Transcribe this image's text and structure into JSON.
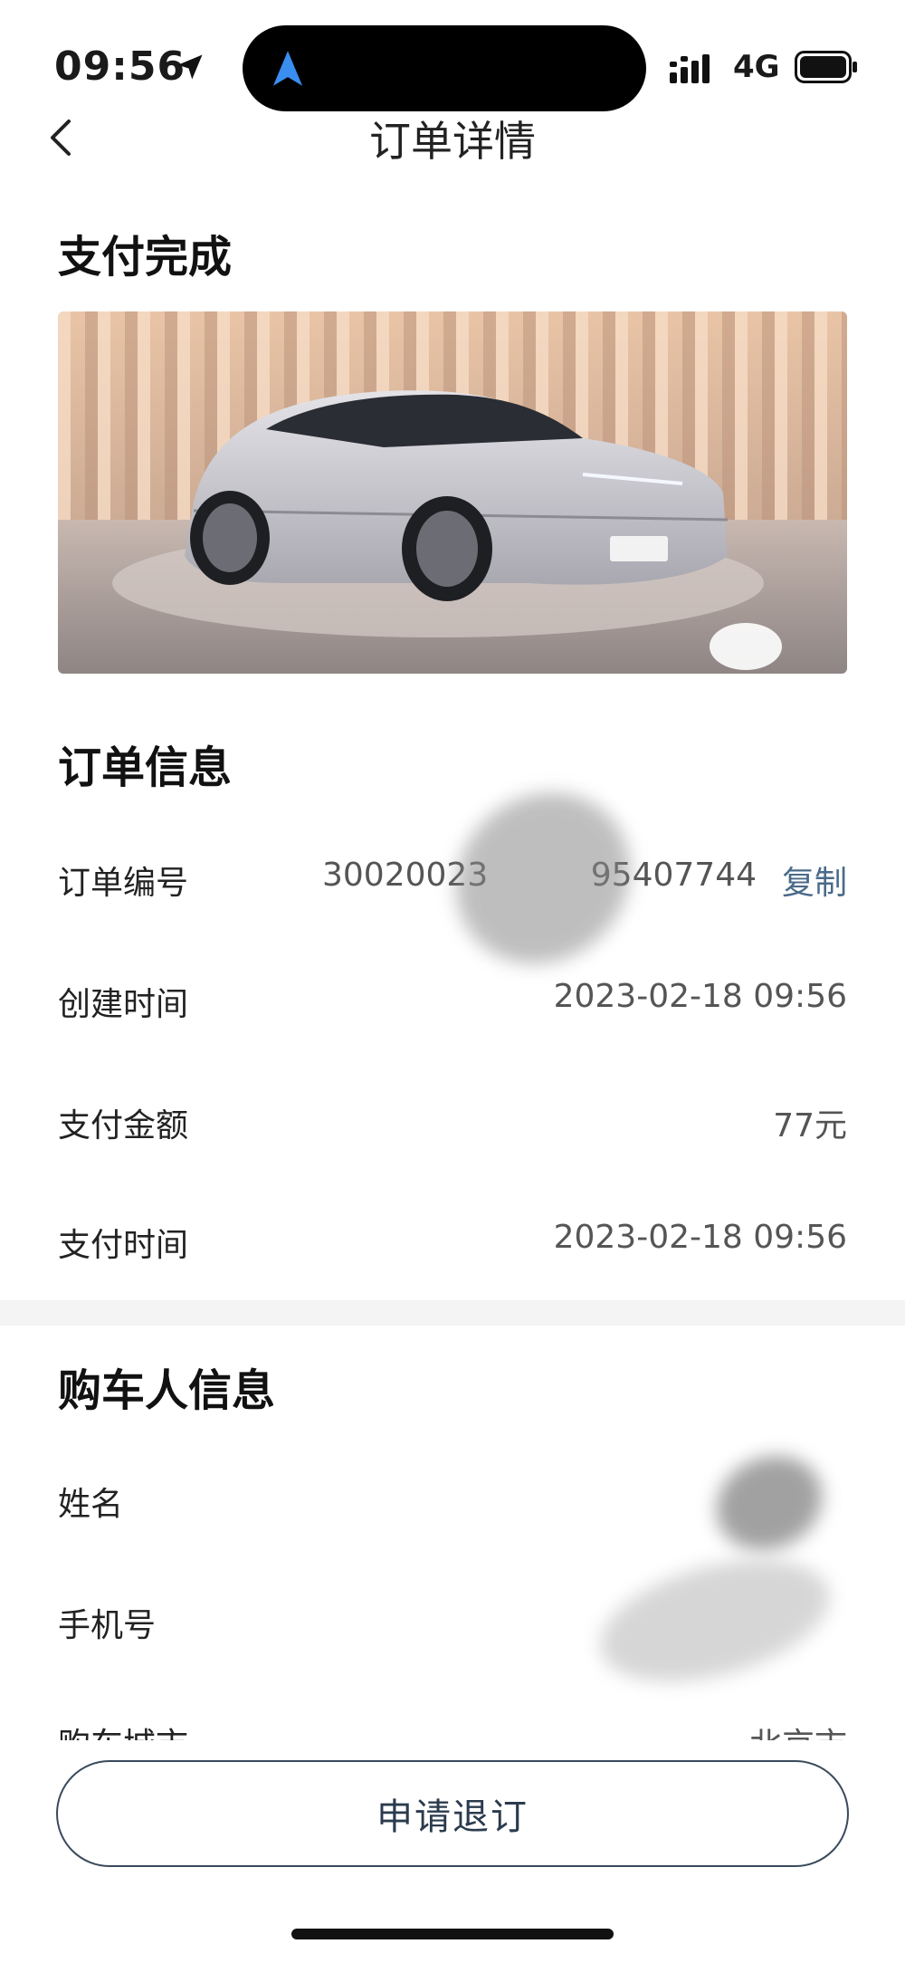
{
  "status_bar": {
    "time": "09:56",
    "network": "4G"
  },
  "nav": {
    "title": "订单详情"
  },
  "payment_status": "支付完成",
  "order_info": {
    "title": "订单信息",
    "order_number_label": "订单编号",
    "order_number_value": "30020023",
    "order_number_value_end": "95407744",
    "copy_label": "复制",
    "created_time_label": "创建时间",
    "created_time_value": "2023-02-18 09:56",
    "amount_label": "支付金额",
    "amount_value": "77元",
    "paid_time_label": "支付时间",
    "paid_time_value": "2023-02-18 09:56"
  },
  "buyer_info": {
    "title": "购车人信息",
    "name_label": "姓名",
    "name_value": "",
    "phone_label": "手机号",
    "phone_value": "",
    "city_label": "购车城市",
    "city_value": "北京市"
  },
  "refund_button": "申请退订",
  "colors": {
    "accent_link": "#4a6a8a",
    "button_border": "#3a4a5c",
    "nav_arrow": "#3a8ef0"
  }
}
